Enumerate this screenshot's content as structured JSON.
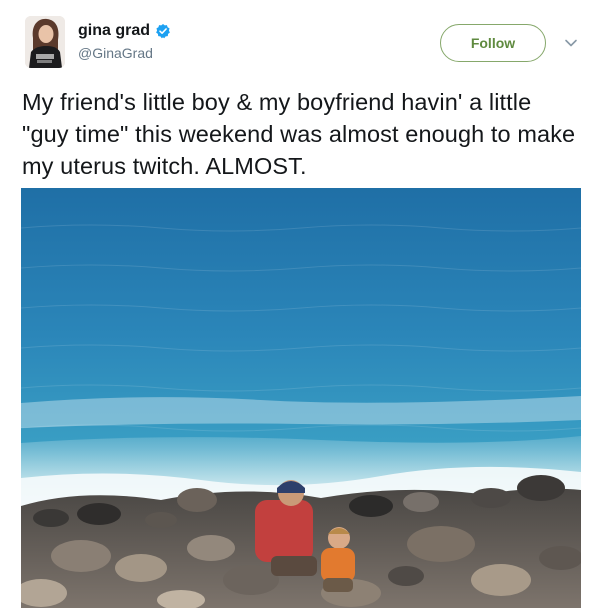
{
  "tweet": {
    "author": {
      "display_name": "gina grad",
      "handle": "@GinaGrad",
      "verified_icon": "verified-badge-icon",
      "avatar_icon": "avatar-image"
    },
    "follow_label": "Follow",
    "more_icon": "chevron-down-icon",
    "text": "My friend's little boy & my boyfriend havin' a little \"guy time\" this weekend was almost enough to make my uterus twitch. ALMOST.",
    "media_description_icon": "photo-beach"
  },
  "colors": {
    "follow_accent": "#5f8a3f",
    "verified_blue": "#1da1f2",
    "text_primary": "#14171a",
    "text_secondary": "#657786"
  }
}
